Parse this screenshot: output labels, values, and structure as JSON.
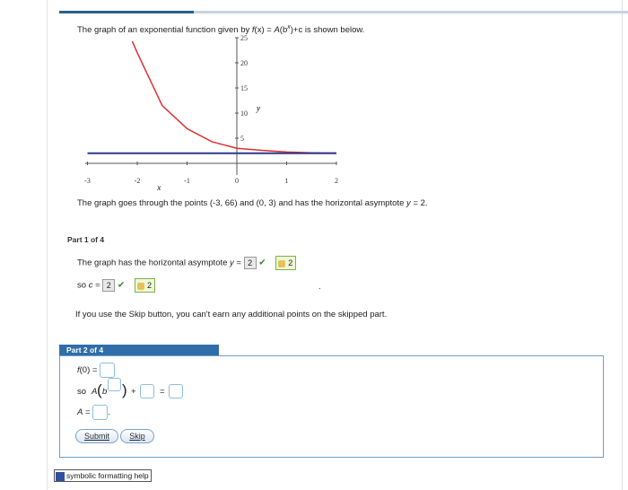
{
  "prompt": {
    "pre": "The graph of an exponential function given by ",
    "fx": "f",
    "x_arg": "(x) = ",
    "A": "A",
    "b": "(b",
    "exp": "x",
    "post": ")+c is shown below."
  },
  "chart_data": {
    "type": "line",
    "x_ticks": [
      "-3",
      "-2",
      "-1",
      "0",
      "1",
      "2"
    ],
    "y_ticks": [
      "5",
      "10",
      "15",
      "20",
      "25"
    ],
    "xlabel": "x",
    "ylabel": "y",
    "xlim": [
      -3,
      2
    ],
    "ylim": [
      0,
      25
    ],
    "series": [
      {
        "color": "#e03030",
        "x": [
          -2.1,
          -2,
          -1.5,
          -1,
          -0.5,
          0,
          0.5,
          1,
          1.5,
          2
        ],
        "y": [
          24.3,
          22.0,
          11.5,
          6.9,
          4.3,
          3.0,
          2.6,
          2.25,
          2.1,
          2.05
        ]
      },
      {
        "color": "#2d3a8c",
        "x": [
          -3,
          2
        ],
        "y": [
          2,
          2
        ]
      }
    ]
  },
  "through_text": "The graph goes through the points (-3, 66) and (0, 3) and has the horizontal asymptote ",
  "through_y": "y",
  "through_eq": " = 2.",
  "part1": {
    "header": "Part 1 of 4",
    "line1": "The graph has the horizontal asymptote ",
    "line1_y": "y",
    "line1_eq": " = ",
    "answer1": "2",
    "key1": "2",
    "line2": "so ",
    "line2_c": "c",
    "line2_eq": " = ",
    "answer2": "2",
    "key2": "2",
    "dot": "."
  },
  "skip_note": "If you use the Skip button, you can't earn any additional points on the skipped part.",
  "part2": {
    "header": "Part 2 of 4",
    "f0": "f",
    "f0_rest": "(0) = ",
    "so": "so ",
    "A": "A",
    "b": "b",
    "plus": "+",
    "eq": "=",
    "A2": "A",
    "A2_eq": " = ",
    "period": "."
  },
  "buttons": {
    "submit": "Submit",
    "skip": "Skip"
  },
  "help": {
    "label": "symbolic formatting help"
  },
  "colors": {
    "accent": "#2f6ea8",
    "curve": "#e03030",
    "asymptote": "#2d3a8c",
    "check": "#3a8a2a"
  }
}
